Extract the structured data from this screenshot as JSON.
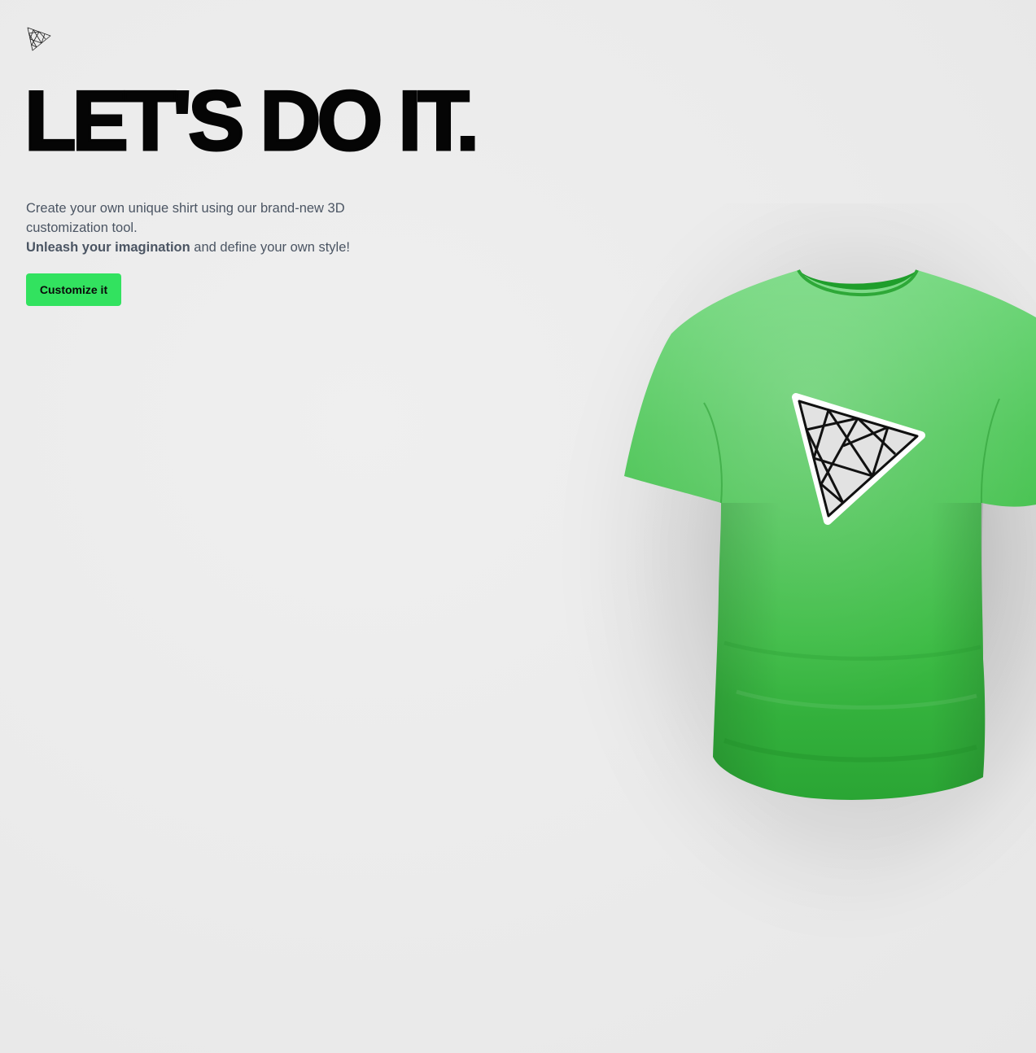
{
  "logo": {
    "icon": "threejs-triangle-logo"
  },
  "hero": {
    "title": "LET'S DO IT.",
    "description_line1": "Create your own unique shirt using our brand-new 3D customization tool.",
    "description_bold": "Unleash your imagination",
    "description_rest": " and define your own style!",
    "cta_label": "Customize it"
  },
  "shirt": {
    "color": "#3fbf45",
    "decal_icon": "threejs-triangle-logo"
  },
  "colors": {
    "accent": "#32e25f",
    "background": "#ececec",
    "title": "#050505",
    "body_text": "#4b5563"
  }
}
